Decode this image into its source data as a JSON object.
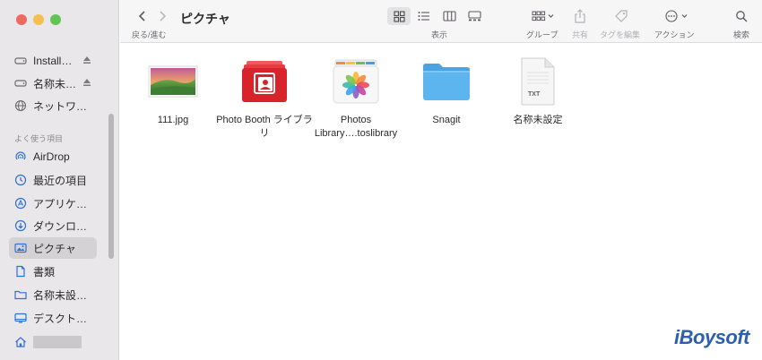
{
  "window": {
    "title": "ピクチャ",
    "nav_label": "戻る/進む"
  },
  "toolbar": {
    "view_label": "表示",
    "group_label": "グループ",
    "share_label": "共有",
    "tag_label": "タグを編集",
    "action_label": "アクション",
    "search_label": "検索"
  },
  "sidebar": {
    "devices": [
      {
        "label": "Install…",
        "icon": "disk-icon",
        "eject": true
      },
      {
        "label": "名称未…",
        "icon": "disk-icon",
        "eject": true
      },
      {
        "label": "ネットワ…",
        "icon": "globe-icon",
        "eject": false
      }
    ],
    "favorites_header": "よく使う項目",
    "favorites": [
      {
        "label": "AirDrop",
        "icon": "airdrop-icon"
      },
      {
        "label": "最近の項目",
        "icon": "clock-icon"
      },
      {
        "label": "アプリケ…",
        "icon": "apps-icon"
      },
      {
        "label": "ダウンロ…",
        "icon": "download-icon"
      },
      {
        "label": "ピクチャ",
        "icon": "photo-icon",
        "selected": true
      },
      {
        "label": "書類",
        "icon": "document-icon"
      },
      {
        "label": "名称未設…",
        "icon": "folder-icon"
      },
      {
        "label": "デスクト…",
        "icon": "desktop-icon"
      }
    ],
    "home_icon": "home-icon"
  },
  "files": [
    {
      "name": "111.jpg",
      "kind": "image"
    },
    {
      "name": "Photo Booth ライブラリ",
      "kind": "photobooth"
    },
    {
      "name": "Photos Library….toslibrary",
      "kind": "photos"
    },
    {
      "name": "Snagit",
      "kind": "folder"
    },
    {
      "name": "名称未設定",
      "kind": "txt",
      "badge": "TXT"
    }
  ],
  "brand": "iBoysoft",
  "colors": {
    "accent": "#2f6fd6",
    "folder": "#5db5ef",
    "photobooth": "#d8232a"
  }
}
